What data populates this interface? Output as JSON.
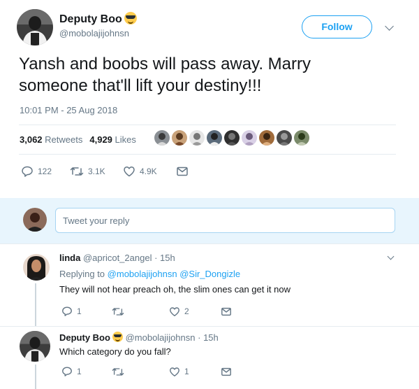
{
  "tweet": {
    "author_name": "Deputy Boo",
    "author_handle": "@mobolajijohnsn",
    "follow_label": "Follow",
    "text_line1": "Yansh and boobs will pass away. Marry",
    "text_line2": "someone that'll lift your destiny!!!",
    "timestamp": "10:01 PM - 25 Aug 2018",
    "retweets_count": "3,062",
    "retweets_label": "Retweets",
    "likes_count": "4,929",
    "likes_label": "Likes",
    "liker_avatar_count": 9,
    "actions": {
      "replies": "122",
      "retweets": "3.1K",
      "likes": "4.9K"
    }
  },
  "reply_box": {
    "placeholder": "Tweet your reply"
  },
  "replies": [
    {
      "name": "linda",
      "handle": "@apricot_2angel",
      "time": "· 15h",
      "replying_prefix": "Replying to",
      "replying_to_1": "@mobolajijohnsn",
      "replying_to_2": "@Sir_Dongizle",
      "text": "They will not hear preach oh, the slim ones can get it now",
      "replies": "1",
      "retweets": "",
      "likes": "2"
    },
    {
      "name": "Deputy Boo",
      "handle": "@mobolajijohnsn",
      "time": "· 15h",
      "text": "Which category do you fall?",
      "replies": "1",
      "retweets": "",
      "likes": "1"
    }
  ],
  "colors": {
    "accent": "#1da1f2",
    "secondary_text": "#657786",
    "divider": "#e6ecf0",
    "reply_bg": "#e8f5fd",
    "thread_line": "#ccd6dd"
  }
}
